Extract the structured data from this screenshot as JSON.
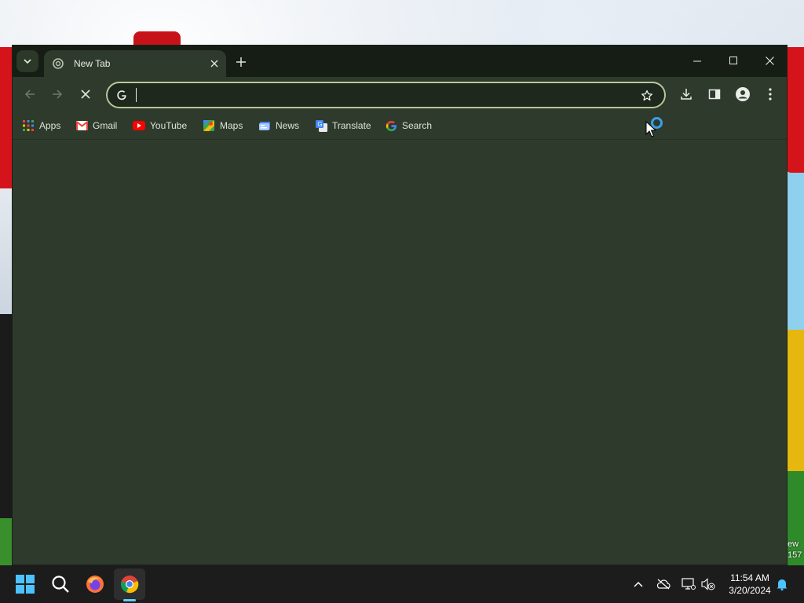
{
  "desktop": {
    "label_line1": "ew",
    "label_line2": "157"
  },
  "browser": {
    "tab": {
      "title": "New Tab"
    },
    "omnibox": {
      "value": "",
      "placeholder": ""
    },
    "bookmarks": [
      {
        "label": "Apps",
        "icon": "apps-grid-icon"
      },
      {
        "label": "Gmail",
        "icon": "gmail-icon"
      },
      {
        "label": "YouTube",
        "icon": "youtube-icon"
      },
      {
        "label": "Maps",
        "icon": "maps-icon"
      },
      {
        "label": "News",
        "icon": "news-icon"
      },
      {
        "label": "Translate",
        "icon": "translate-icon"
      },
      {
        "label": "Search",
        "icon": "google-icon"
      }
    ],
    "colors": {
      "frame": "#161d14",
      "toolbar": "#2e3a2b",
      "omnibox_border": "#b9c79a",
      "loading_spinner": "#3b9ee8"
    }
  },
  "taskbar": {
    "apps": [
      "start-icon",
      "search-icon",
      "firefox-icon",
      "chrome-icon"
    ],
    "active_app": "chrome",
    "time": "11:54 AM",
    "date": "3/20/2024"
  }
}
